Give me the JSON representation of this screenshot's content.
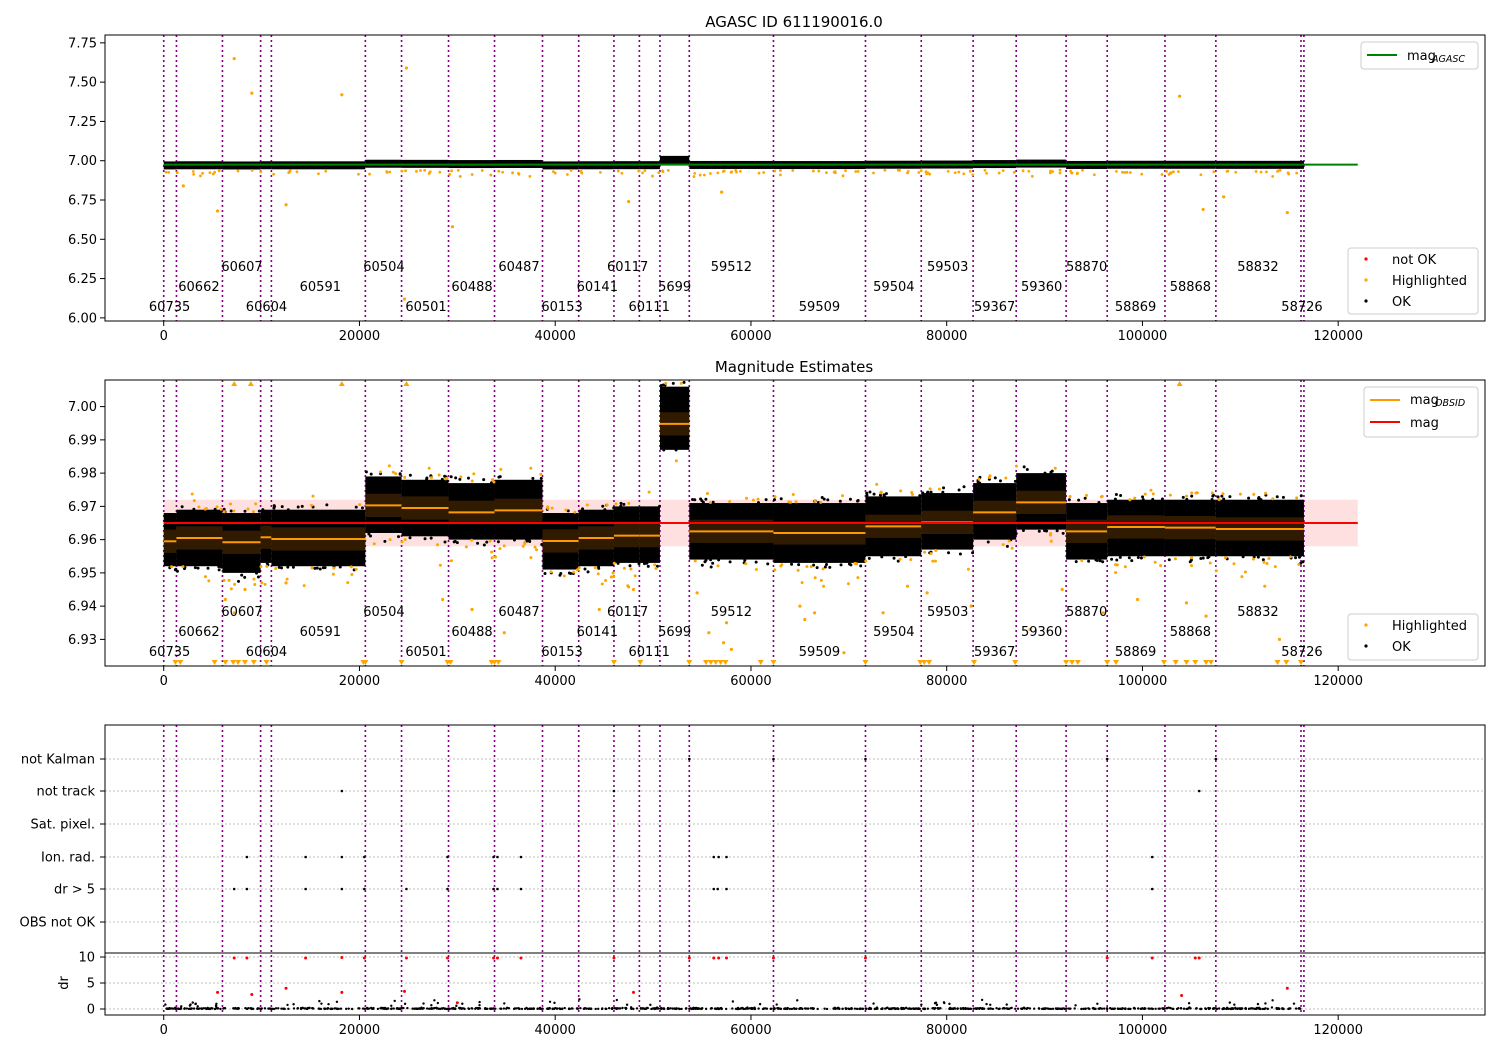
{
  "chart_data": [
    {
      "type": "scatter",
      "title": "AGASC ID 611190016.0",
      "xlim": [
        -6000,
        135000
      ],
      "ylim": [
        5.98,
        7.8
      ],
      "yticks": [
        "6.00",
        "6.25",
        "6.50",
        "6.75",
        "7.00",
        "7.25",
        "7.50",
        "7.75"
      ],
      "xticks": [
        "0",
        "20000",
        "40000",
        "60000",
        "80000",
        "100000",
        "120000"
      ],
      "mag_agasc": 6.975,
      "legend_upper": {
        "position": "top-right",
        "entries": [
          "mag_AGASC"
        ]
      },
      "legend_lower": {
        "position": "bottom-right",
        "entries": [
          "not OK",
          "Highlighted",
          "OK"
        ]
      },
      "grid": false
    },
    {
      "type": "scatter",
      "title": "Magnitude Estimates",
      "xlim": [
        -6000,
        135000
      ],
      "ylim": [
        6.922,
        7.008
      ],
      "yticks": [
        "6.93",
        "6.94",
        "6.95",
        "6.96",
        "6.97",
        "6.98",
        "6.99",
        "7.00"
      ],
      "xticks": [
        "0",
        "20000",
        "40000",
        "60000",
        "80000",
        "100000",
        "120000"
      ],
      "mag": 6.965,
      "mag_band": [
        6.958,
        6.972
      ],
      "legend_upper": {
        "position": "top-right",
        "entries": [
          "mag_OBSID",
          "mag"
        ]
      },
      "legend_lower": {
        "position": "bottom-right",
        "entries": [
          "Highlighted",
          "OK"
        ]
      },
      "grid": false
    },
    {
      "type": "scatter",
      "title": "",
      "xlim": [
        -6000,
        135000
      ],
      "ylabel_lower": "dr",
      "flag_rows": [
        "not Kalman",
        "not track",
        "Sat. pixel.",
        "Ion. rad.",
        "dr > 5",
        "OBS not OK"
      ],
      "dr_ticks": [
        "0",
        "5",
        "10"
      ],
      "xticks": [
        "0",
        "20000",
        "40000",
        "60000",
        "80000",
        "100000",
        "120000"
      ]
    }
  ],
  "obsids": [
    {
      "id": "60735",
      "start": 0,
      "end": 1300,
      "mean": 6.9595,
      "lo": 6.952,
      "hi": 6.968
    },
    {
      "id": "60662",
      "start": 1300,
      "end": 6000,
      "mean": 6.9605,
      "lo": 6.952,
      "hi": 6.969
    },
    {
      "id": "60607",
      "start": 6000,
      "end": 9900,
      "mean": 6.9592,
      "lo": 6.95,
      "hi": 6.968
    },
    {
      "id": "60604",
      "start": 9900,
      "end": 11000,
      "mean": 6.9607,
      "lo": 6.953,
      "hi": 6.969
    },
    {
      "id": "60591",
      "start": 11000,
      "end": 20600,
      "mean": 6.9602,
      "lo": 6.952,
      "hi": 6.969
    },
    {
      "id": "60504",
      "start": 20600,
      "end": 24300,
      "mean": 6.9703,
      "lo": 6.962,
      "hi": 6.979
    },
    {
      "id": "60501",
      "start": 24300,
      "end": 29100,
      "mean": 6.9695,
      "lo": 6.961,
      "hi": 6.978
    },
    {
      "id": "60488",
      "start": 29100,
      "end": 33800,
      "mean": 6.9682,
      "lo": 6.96,
      "hi": 6.977
    },
    {
      "id": "60487",
      "start": 33800,
      "end": 38700,
      "mean": 6.9688,
      "lo": 6.96,
      "hi": 6.978
    },
    {
      "id": "60153",
      "start": 38700,
      "end": 42400,
      "mean": 6.9596,
      "lo": 6.951,
      "hi": 6.968
    },
    {
      "id": "60141",
      "start": 42400,
      "end": 46000,
      "mean": 6.9605,
      "lo": 6.952,
      "hi": 6.969
    },
    {
      "id": "60117",
      "start": 46000,
      "end": 48600,
      "mean": 6.9612,
      "lo": 6.953,
      "hi": 6.97
    },
    {
      "id": "60111",
      "start": 48600,
      "end": 50700,
      "mean": 6.9612,
      "lo": 6.953,
      "hi": 6.97
    },
    {
      "id": "5699",
      "start": 50700,
      "end": 53700,
      "mean": 6.9948,
      "lo": 6.987,
      "hi": 7.006
    },
    {
      "id": "59512",
      "start": 53700,
      "end": 62300,
      "mean": 6.9625,
      "lo": 6.954,
      "hi": 6.971
    },
    {
      "id": "59509",
      "start": 62300,
      "end": 71700,
      "mean": 6.962,
      "lo": 6.953,
      "hi": 6.971
    },
    {
      "id": "59504",
      "start": 71700,
      "end": 77400,
      "mean": 6.964,
      "lo": 6.955,
      "hi": 6.973
    },
    {
      "id": "59503",
      "start": 77400,
      "end": 82700,
      "mean": 6.9652,
      "lo": 6.957,
      "hi": 6.974
    },
    {
      "id": "59367",
      "start": 82700,
      "end": 87100,
      "mean": 6.9682,
      "lo": 6.96,
      "hi": 6.977
    },
    {
      "id": "59360",
      "start": 87100,
      "end": 92200,
      "mean": 6.9712,
      "lo": 6.963,
      "hi": 6.98
    },
    {
      "id": "58870",
      "start": 92200,
      "end": 96400,
      "mean": 6.9625,
      "lo": 6.954,
      "hi": 6.971
    },
    {
      "id": "58869",
      "start": 96400,
      "end": 102300,
      "mean": 6.9638,
      "lo": 6.955,
      "hi": 6.972
    },
    {
      "id": "58868",
      "start": 102300,
      "end": 107500,
      "mean": 6.9636,
      "lo": 6.955,
      "hi": 6.972
    },
    {
      "id": "58832",
      "start": 107500,
      "end": 116200,
      "mean": 6.9632,
      "lo": 6.955,
      "hi": 6.972
    },
    {
      "id": "58726",
      "start": 116200,
      "end": 116500,
      "mean": 6.9632,
      "lo": 6.955,
      "hi": 6.972
    }
  ],
  "obsid_label_rows": [
    2,
    1,
    0,
    2,
    1,
    0,
    2,
    1,
    0,
    2,
    1,
    0,
    2,
    1,
    0,
    2,
    1,
    0,
    2,
    1,
    0,
    2,
    1,
    0,
    2
  ],
  "obsid_label_x": [
    600,
    3600,
    8000,
    10500,
    16000,
    22500,
    26800,
    31500,
    36300,
    40700,
    44300,
    47400,
    49600,
    52200,
    58000,
    67000,
    74600,
    80100,
    84900,
    89700,
    94300,
    99300,
    104900,
    111800,
    116300
  ],
  "outliers_top": [
    [
      7200,
      7.65
    ],
    [
      9000,
      7.43
    ],
    [
      18200,
      7.42
    ],
    [
      24800,
      7.59
    ],
    [
      103800,
      7.41
    ],
    [
      5500,
      6.68
    ],
    [
      12500,
      6.72
    ],
    [
      29500,
      6.58
    ],
    [
      106200,
      6.69
    ],
    [
      114800,
      6.67
    ],
    [
      47500,
      6.74
    ],
    [
      24600,
      6.12
    ],
    [
      108300,
      6.77
    ],
    [
      2000,
      6.84
    ],
    [
      57000,
      6.8
    ]
  ],
  "outliers_mid": [
    [
      6300,
      6.942
    ],
    [
      7200,
      6.938
    ],
    [
      8300,
      6.945
    ],
    [
      12500,
      6.947
    ],
    [
      28500,
      6.942
    ],
    [
      31500,
      6.939
    ],
    [
      34800,
      6.932
    ],
    [
      44500,
      6.939
    ],
    [
      48000,
      6.945
    ],
    [
      54500,
      6.944
    ],
    [
      57500,
      6.935
    ],
    [
      65000,
      6.94
    ],
    [
      66500,
      6.938
    ],
    [
      73500,
      6.938
    ],
    [
      76000,
      6.946
    ],
    [
      82500,
      6.94
    ],
    [
      88500,
      6.933
    ],
    [
      91800,
      6.945
    ],
    [
      96000,
      6.938
    ],
    [
      99500,
      6.942
    ],
    [
      104500,
      6.941
    ],
    [
      106500,
      6.937
    ],
    [
      112500,
      6.946
    ],
    [
      55700,
      6.932
    ],
    [
      57200,
      6.929
    ],
    [
      58000,
      6.927
    ],
    [
      65500,
      6.936
    ],
    [
      69500,
      6.926
    ],
    [
      78000,
      6.944
    ],
    [
      114000,
      6.93
    ]
  ],
  "tri_top": [
    7200,
    8900,
    18200,
    24800,
    103800
  ],
  "tri_bottom": [
    1200,
    1700,
    5200,
    6300,
    7100,
    7600,
    8300,
    9200,
    10500,
    20400,
    20600,
    24300,
    29000,
    29300,
    33500,
    33800,
    34200,
    46000,
    48700,
    53700,
    55400,
    55900,
    56400,
    56900,
    57400,
    61000,
    62300,
    71700,
    77300,
    77700,
    78200,
    82800,
    87000,
    92200,
    92800,
    93400,
    96400,
    97300,
    102200,
    103400,
    104500,
    105400,
    106500,
    107000,
    113800,
    114700,
    116200
  ],
  "flag_points": {
    "not Kalman": [
      53700,
      62300,
      71700,
      96400,
      107500
    ],
    "not track": [
      18200,
      46000,
      105800
    ],
    "Ion. rad.": [
      8500,
      14500,
      18200,
      20500,
      29000,
      33700,
      34100,
      36500,
      56200,
      56700,
      57500,
      101000
    ],
    "dr > 5": [
      7200,
      8500,
      14500,
      18200,
      20500,
      24800,
      29000,
      33700,
      34100,
      36500,
      56200,
      56600,
      57500,
      101000
    ]
  },
  "dr_spikes": [
    [
      7200,
      9.8
    ],
    [
      8500,
      9.8
    ],
    [
      14500,
      9.8
    ],
    [
      18200,
      9.9
    ],
    [
      20500,
      9.8
    ],
    [
      24800,
      9.8
    ],
    [
      29000,
      9.8
    ],
    [
      33700,
      9.8
    ],
    [
      34100,
      9.8
    ],
    [
      36500,
      9.8
    ],
    [
      46000,
      9.8
    ],
    [
      53700,
      9.8
    ],
    [
      56200,
      9.8
    ],
    [
      56700,
      9.8
    ],
    [
      57500,
      9.8
    ],
    [
      62300,
      9.8
    ],
    [
      71700,
      9.8
    ],
    [
      96400,
      9.8
    ],
    [
      101000,
      9.8
    ],
    [
      105400,
      9.8
    ],
    [
      105800,
      9.8
    ],
    [
      5500,
      3.2
    ],
    [
      9000,
      2.8
    ],
    [
      12500,
      4.0
    ],
    [
      24600,
      3.4
    ],
    [
      48000,
      3.2
    ],
    [
      104000,
      2.6
    ],
    [
      114800,
      4.0
    ],
    [
      18200,
      3.2
    ],
    [
      30000,
      1.2
    ]
  ],
  "colors": {
    "ok": "#000000",
    "highlighted": "#ffa500",
    "not_ok": "#ff0000",
    "agasc_line": "#008000",
    "mag_line": "#ff0000",
    "obsid_line": "#ff9900",
    "band": "#ffcccc",
    "vline": "#800080",
    "grid": "#b0b0b0"
  },
  "legend_labels": {
    "mag_agasc_main": "mag",
    "mag_agasc_sub": "AGASC",
    "mag_obsid_main": "mag",
    "mag_obsid_sub": "OBSID",
    "mag": "mag",
    "not_ok": "not OK",
    "highlighted": "Highlighted",
    "ok": "OK"
  }
}
